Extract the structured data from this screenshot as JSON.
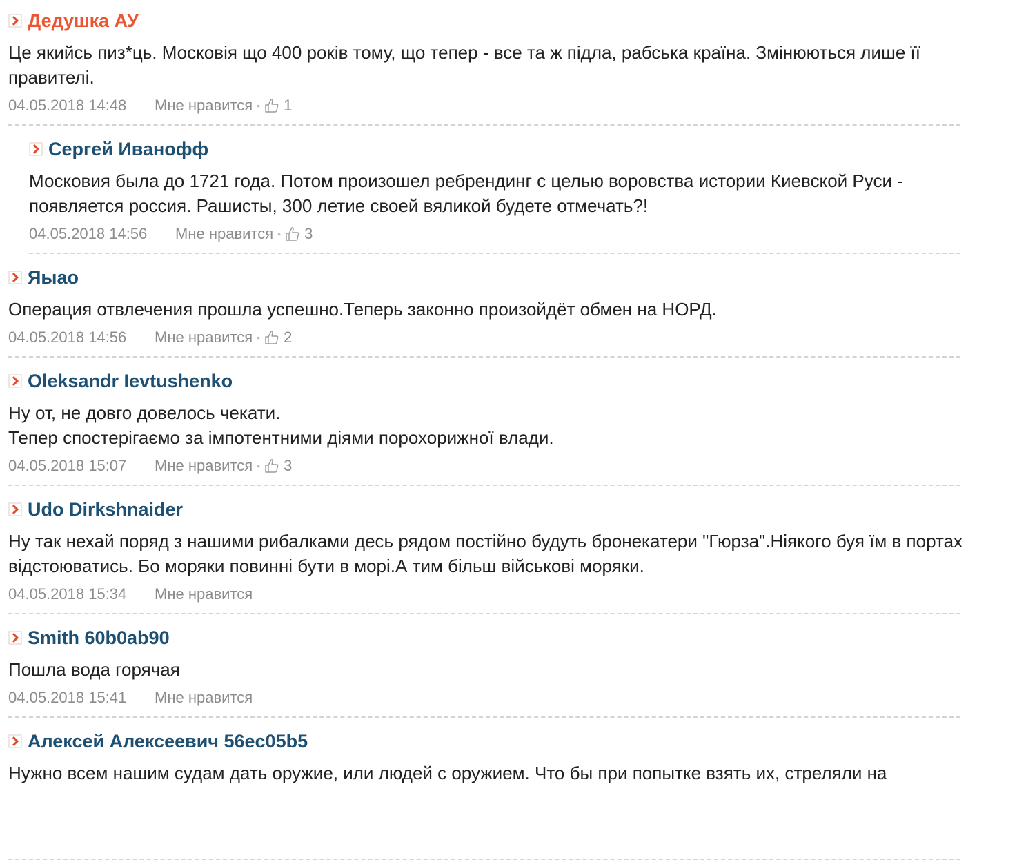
{
  "comments": [
    {
      "author": "Дедушка АУ",
      "owner": true,
      "text": "Це якийсь пиз*ць. Московія що 400 років тому, що тепер - все та ж підла, рабська країна. Змінюються лише її правителі.",
      "date": "04.05.2018 14:48",
      "like_label": "Мне нравится",
      "likes": "1"
    },
    {
      "author": "Сергей Иванофф",
      "reply": true,
      "text": "Московия была до 1721 года. Потом произошел ребрендинг с целью воровства истории Киевской Руси - появляется россия. Рашисты, 300 летие своей вяликой будете отмечать?!",
      "date": "04.05.2018 14:56",
      "like_label": "Мне нравится",
      "likes": "3"
    },
    {
      "author": "Яыао",
      "text": "Операция отвлечения прошла успешно.Теперь законно произойдёт обмен на НОРД.",
      "date": "04.05.2018 14:56",
      "like_label": "Мне нравится",
      "likes": "2"
    },
    {
      "author": "Oleksandr Ievtushenko",
      "text": "Ну от, не довго довелось чекати.\nТепер спостерігаємо за імпотентними діями порохорижної влади.",
      "date": "04.05.2018 15:07",
      "like_label": "Мне нравится",
      "likes": "3"
    },
    {
      "author": "Udo Dirkshnaider",
      "text": "Ну так нехай поряд з нашими рибалками десь рядом постійно будуть бронекатери \"Гюрза\".Ніякого буя їм в портах відстоюватись. Бо моряки повинні бути в морі.А тим більш військові моряки.",
      "date": "04.05.2018 15:34",
      "like_label": "Мне нравится",
      "likes": ""
    },
    {
      "author": "Smith 60b0ab90",
      "text": "Пошла вода горячая",
      "date": "04.05.2018 15:41",
      "like_label": "Мне нравится",
      "likes": ""
    },
    {
      "author": "Алексей Алексеевич 56ec05b5",
      "text": "Нужно всем нашим судам дать оружие, или людей с оружием. Что бы при попытке взять их, стреляли на",
      "date": "",
      "like_label": "",
      "likes": ""
    }
  ],
  "colors": {
    "author": "#1d5073",
    "owner": "#ea5632",
    "meta": "#8c8c8c",
    "arrow": "#e2492b"
  },
  "icons": {
    "arrow": "chevron-right-icon",
    "like": "thumbs-up-icon"
  }
}
